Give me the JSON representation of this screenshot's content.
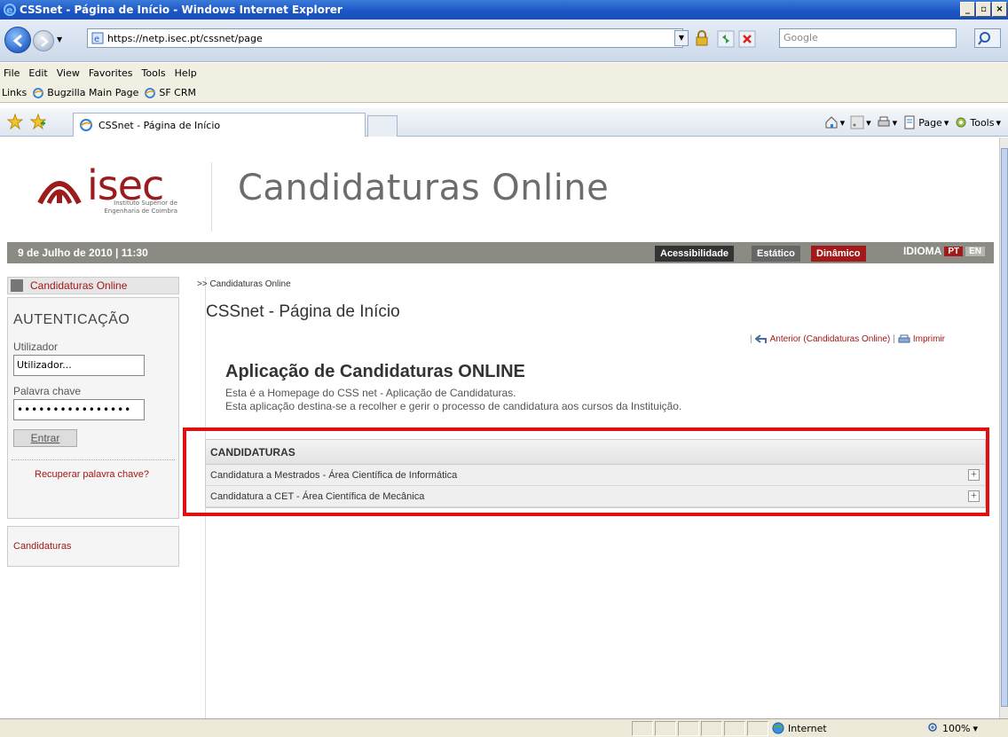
{
  "window": {
    "title": "CSSnet - Página de Início - Windows Internet Explorer",
    "controls": [
      "_",
      "▫",
      "×"
    ]
  },
  "address": {
    "url": "https://netp.isec.pt/cssnet/page",
    "search_placeholder": "Google"
  },
  "menu": [
    "File",
    "Edit",
    "View",
    "Favorites",
    "Tools",
    "Help"
  ],
  "links_bar": {
    "label": "Links",
    "items": [
      "Bugzilla Main Page",
      "SF CRM"
    ]
  },
  "tabs": {
    "active": "CSSnet - Página de Início"
  },
  "command_bar": {
    "page": "Page",
    "tools": "Tools"
  },
  "site": {
    "logo_word": "isec",
    "logo_sub": [
      "Instituto Superior de",
      "Engenharia de Coimbra"
    ],
    "title": "Candidaturas Online"
  },
  "infobar": {
    "date": "9 de Julho de 2010 | 11:30",
    "acessibilidade": "Acessibilidade",
    "estatico": "Estático",
    "dinamico": "Dinâmico",
    "idioma": "IDIOMA",
    "pt": "PT",
    "en": "EN"
  },
  "sidebar": {
    "home_label": "Candidaturas Online",
    "auth_title": "AUTENTICAÇÃO",
    "user_label": "Utilizador",
    "user_value": "Utilizador...",
    "pw_label": "Palavra chave",
    "pw_value": "••••••••••••••••",
    "enter": "Entrar",
    "recover": "Recuperar palavra chave?",
    "candidaturas": "Candidaturas"
  },
  "main": {
    "breadcrumb": ">> Candidaturas Online",
    "page_title": "CSSnet - Página de Início",
    "back_link": "Anterior (Candidaturas Online)",
    "print_link": "Imprimir",
    "app_title": "Aplicação de Candidaturas ONLINE",
    "desc_1": "Esta é a Homepage do CSS net - Aplicação de Candidaturas.",
    "desc_2": "Esta aplicação destina-se a recolher e gerir o processo de candidatura aos cursos da Instituição.",
    "table_header": "CANDIDATURAS",
    "rows": [
      "Candidatura a Mestrados - Área Científica de Informática",
      "Candidatura a CET - Área Científica de Mecânica"
    ]
  },
  "status": {
    "zone": "Internet",
    "zoom": "100%"
  },
  "colors": {
    "accent_red": "#a31818",
    "info_gray": "#8b8b84",
    "highlight": "#e01010"
  }
}
